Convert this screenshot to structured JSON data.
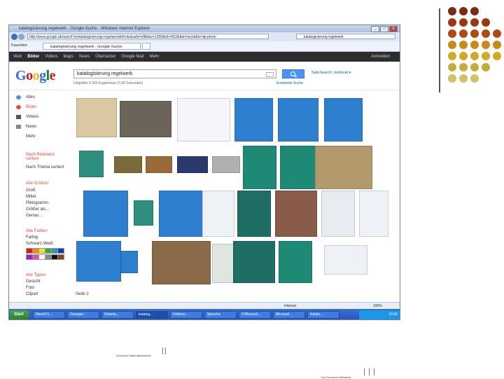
{
  "ie": {
    "title": "katalogisierung regelwerk - Google-Suche - Windows Internet Explorer",
    "url": "http://www.google.at/search?q=katalogisierung+regelwerk&hl=de&safe=off&biw=1280&bih=822&tbm=isch&tbs=itp:photo",
    "search_box": "katalogisierung regelwerk",
    "favorites_label": "Favoriten",
    "tab_label": "katalogisierung regelwerk - Google-Suche",
    "win_controls": [
      "_",
      "□",
      "X"
    ]
  },
  "google_bar": {
    "links": [
      "Web",
      "Bilder",
      "Videos",
      "Maps",
      "News",
      "Übersetzer",
      "Google Mail",
      "Mehr"
    ],
    "active": "Bilder",
    "signin": "Anmelden"
  },
  "logo": {
    "letters": [
      "G",
      "o",
      "o",
      "g",
      "l",
      "e"
    ],
    "colors": [
      "#3369e8",
      "#d50f25",
      "#eeb211",
      "#3369e8",
      "#009925",
      "#d50f25"
    ]
  },
  "search": {
    "query": "katalogisierung regelwerk",
    "stats": "Ungefähr 9.300 Ergebnisse (0,36 Sekunden)",
    "safe_search": "SafeSearch: moderat ▾",
    "advanced": "Erweiterte Suche"
  },
  "left_nav": {
    "types": [
      "Alles",
      "Bilder",
      "Videos",
      "News",
      "Mehr"
    ],
    "sort_head": "Nach Relevanz sortiert",
    "sort_alt": "Nach Thema sortiert",
    "size_head": "Alle Größen",
    "sizes": [
      "Groß",
      "Mittel",
      "Piktogramm",
      "Größer als...",
      "Genau..."
    ],
    "color_head": "Alle Farben",
    "colors": [
      "Farbig",
      "Schwarz-Weiß"
    ],
    "type_head": "Alle Typen",
    "types2": [
      "Gesicht",
      "Foto",
      "Clipart"
    ],
    "swatch_colors": [
      "#d81e1e",
      "#f08a1a",
      "#f4e31c",
      "#37a92f",
      "#2b93d1",
      "#1933b5",
      "#8f2bc1",
      "#e84aa7",
      "#ffffff",
      "#8a8a8a",
      "#111111",
      "#7a4a21"
    ]
  },
  "results": {
    "page_label": "Seite 2"
  },
  "status_bar": {
    "zone": "Internet",
    "zoom": "100%"
  },
  "taskbar": {
    "start": "Start",
    "buttons": [
      "Novell G...",
      "Groupwi...",
      "Downlo...",
      "katalog...",
      "Unbene...",
      "Sprache",
      "4 Microsof...",
      "Microsof...",
      "Katalo..."
    ],
    "active_index": 3,
    "clock": "15:56"
  },
  "slide": {
    "dot_colors": [
      "#7b2a14",
      "#9a3a12",
      "#b04a14",
      "#c0601a",
      "#c98a1a",
      "#d1a828",
      "#bfae3a",
      "#c4b84e",
      "#cfc36a"
    ],
    "caption_left": "Deutsche Nationalbibliothek",
    "caption_right": "Die Deutsche Bibliothek"
  }
}
